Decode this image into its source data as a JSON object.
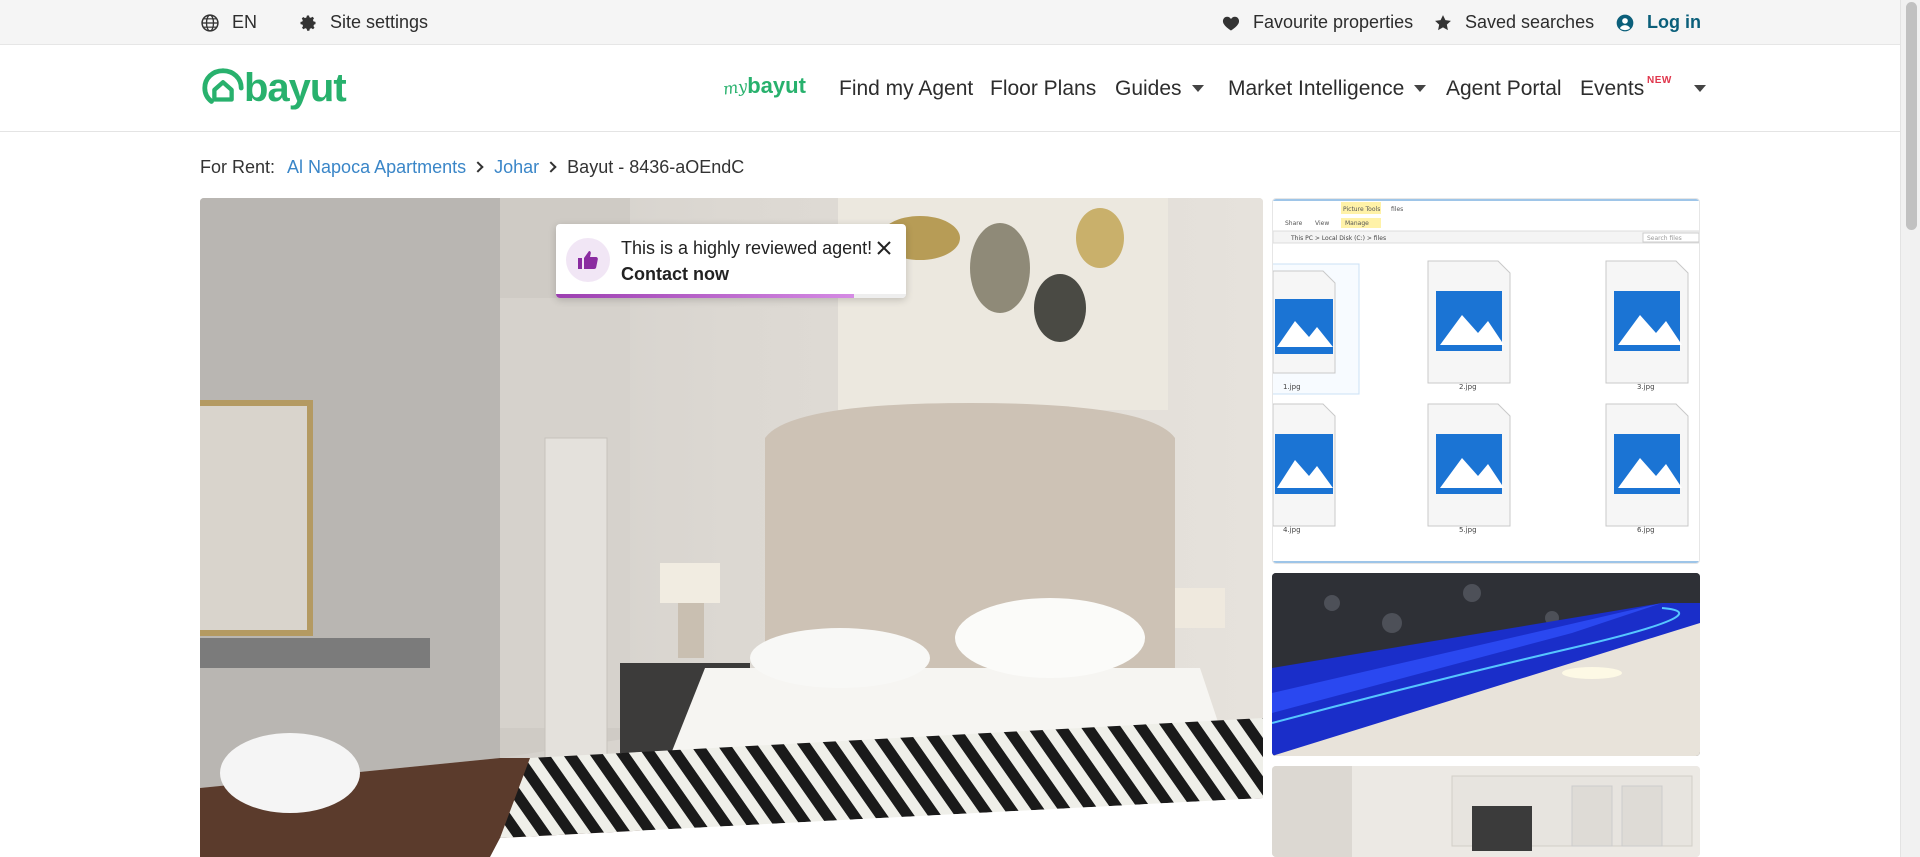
{
  "topbar": {
    "language": "EN",
    "site_settings": "Site settings",
    "favourites": "Favourite properties",
    "saved_searches": "Saved searches",
    "login": "Log in"
  },
  "header": {
    "logo_text": "bayut",
    "mybayut_my": "my",
    "mybayut_brand": "bayut",
    "nav": {
      "find_agent": "Find my Agent",
      "floor_plans": "Floor Plans",
      "guides": "Guides",
      "market_intelligence": "Market Intelligence",
      "agent_portal": "Agent Portal",
      "events": "Events",
      "events_badge": "NEW"
    }
  },
  "breadcrumb": {
    "label": "For Rent:",
    "items": [
      "Al Napoca Apartments",
      "Johar"
    ],
    "current": "Bayut - 8436-aOEndC"
  },
  "toast": {
    "message": "This is a highly reviewed agent!",
    "cta": "Contact now",
    "progress": 0.85
  },
  "gallery": {
    "thumb1_files": [
      "1.jpg",
      "2.jpg",
      "3.jpg",
      "4.jpg",
      "5.jpg",
      "6.jpg"
    ],
    "thumb1_path": "This PC > Local Disk (C:) > files",
    "thumb1_search": "Search files",
    "thumb1_tabs": [
      "Share",
      "View",
      "Manage"
    ],
    "thumb1_tools": "Picture Tools",
    "thumb1_title": "files"
  },
  "colors": {
    "brand_green": "#28b16d",
    "link_blue": "#3a86c8",
    "login_teal": "#0b5f7a",
    "toast_accent": "#9c3fb0",
    "badge_red": "#e0364c"
  }
}
